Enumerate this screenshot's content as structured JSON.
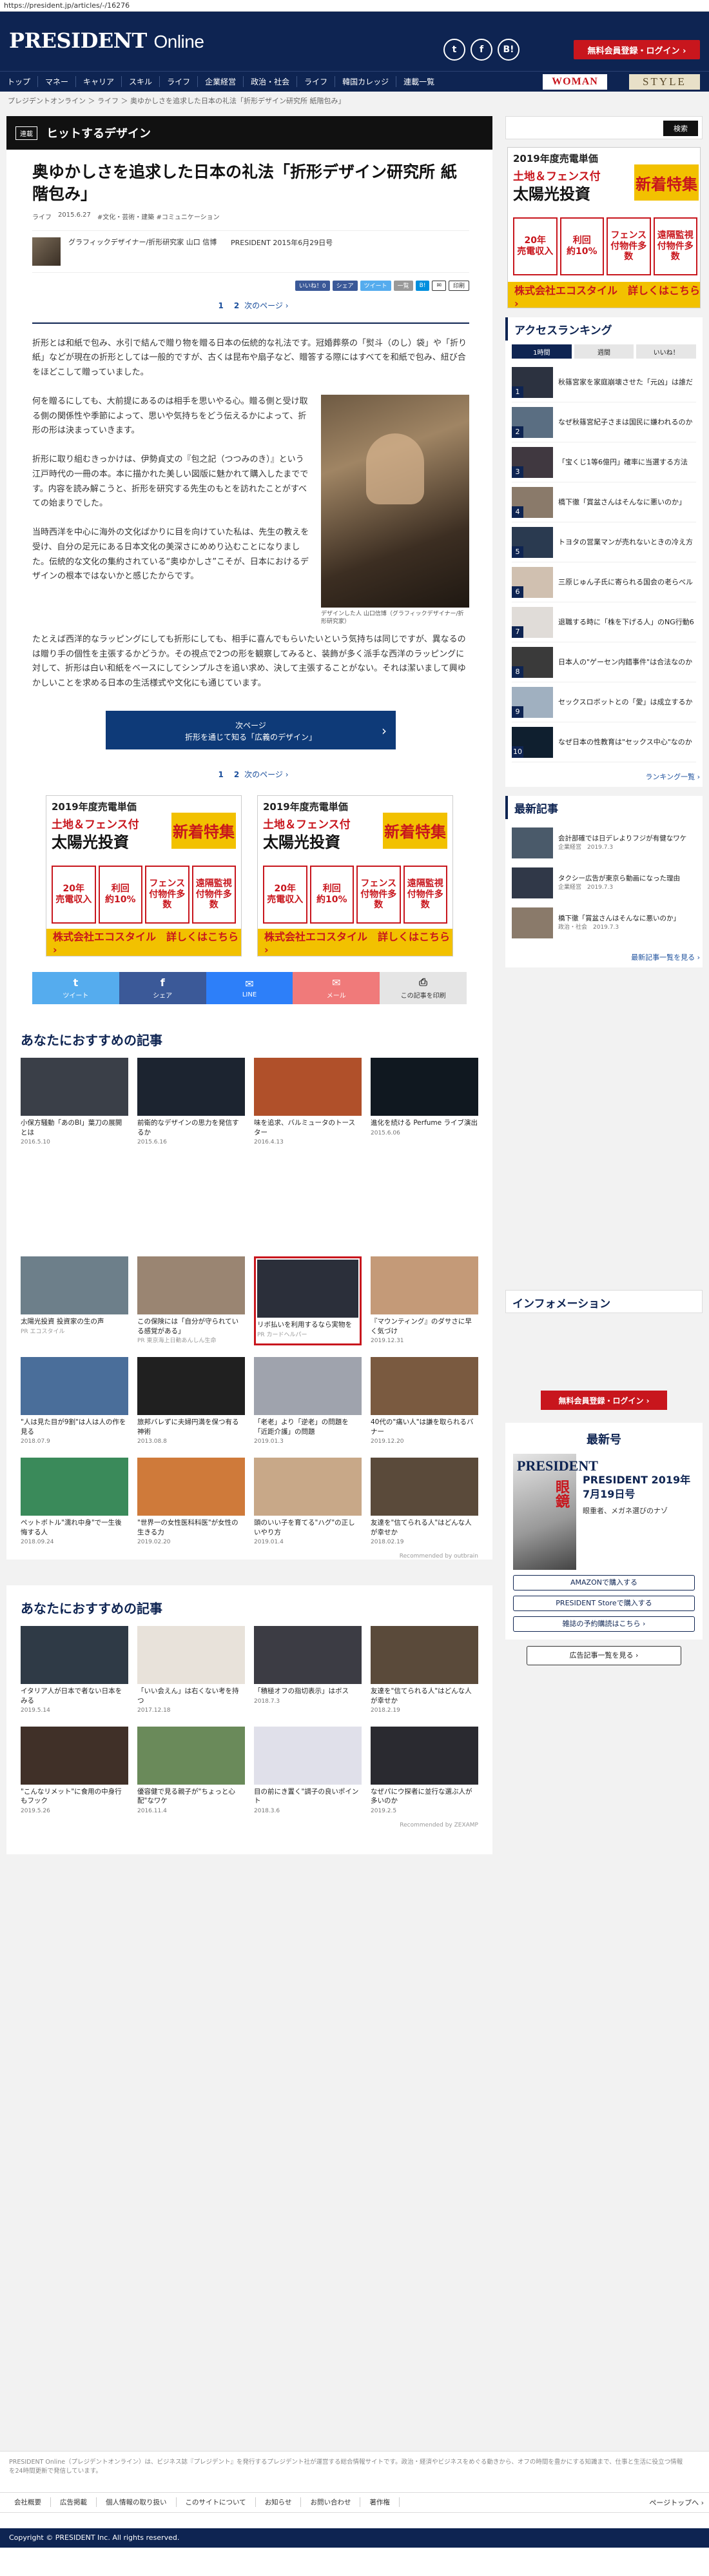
{
  "url": "https://president.jp/articles/-/16276",
  "header": {
    "logo_main": "PRESIDENT",
    "logo_sub": "Online",
    "social": [
      "t",
      "f",
      "B!"
    ],
    "register": "無料会員登録・ログイン ›"
  },
  "nav": {
    "items": [
      "トップ",
      "マネー",
      "キャリア",
      "スキル",
      "ライフ",
      "企業経営",
      "政治・社会",
      "ライフ",
      "韓国カレッジ",
      "連載一覧"
    ],
    "woman": "WOMAN",
    "style": "STYLE"
  },
  "breadcrumb": "プレジデントオンライン ＞ ライフ ＞ 奥ゆかしさを追求した日本の礼法「折形デザイン研究所 紙階包み」",
  "corner": {
    "tag": "連載",
    "name": "ヒットするデザイン"
  },
  "article": {
    "title": "奥ゆかしさを追求した日本の礼法「折形デザイン研究所 紙階包み」",
    "category": "ライフ",
    "date": "2015.6.27",
    "tags": "#文化・芸術・建築  #コミュニケーション",
    "author": "グラフィックデザイナー/折形研究家 山口 信博",
    "source": "PRESIDENT 2015年6月29日号",
    "share": [
      "いいね！0",
      "シェア",
      "ツイート",
      "一覧",
      "B!",
      "✉",
      "印刷"
    ],
    "pager_1": "1",
    "pager_2": "2",
    "pager_next": "次のページ ›",
    "p1": "折形とは和紙で包み、水引で結んで贈り物を贈る日本の伝統的な礼法です。冠婚葬祭の「熨斗（のし）袋」や「折り紙」などが現在の折形としては一般的ですが、古くは昆布や扇子など、贈答する際にはすべてを和紙で包み、紐び合をほどこして贈っていました。",
    "p2": "何を贈るにしても、大前提にあるのは相手を思いやる心。贈る側と受け取る側の関係性や季節によって、思いや気持ちをどう伝えるかによって、折形の形は決まっていきます。",
    "p3": "折形に取り組むきっかけは、伊勢貞丈の『包之記（つつみのき）』という江戸時代の一冊の本。本に描かれた美しい図版に魅かれて購入したまでです。内容を読み解こうと、折形を研究する先生のもとを訪れたことがすべての始まりでした。",
    "p4": "当時西洋を中心に海外の文化ばかりに目を向けていた私は、先生の教えを受け、自分の足元にある日本文化の美深さにめめり込むことになりました。伝統的な文化の集約されている“奥ゆかしさ”こそが、日本におけるデザインの根本ではないかと感じたからです。",
    "p5": "たとえば西洋的なラッピングにしても折形にしても、相手に喜んでもらいたいという気持ちは同じですが、異なるのは贈り手の個性を主張するかどうか。その視点で2つの形を観察してみると、装飾が多く派手な西洋のラッピングに対して、折形は白い和紙をベースにしてシンプルさを追い求め、決して主張することがない。それは潔いまして興ゆかしいことを求める日本の生活様式や文化にも通じています。",
    "caption": "デザインした人 山口信博（グラフィックデザイナー/折形研究家）",
    "next_line1": "次ページ",
    "next_line2": "折形を通じて知る「広義のデザイン」"
  },
  "ad": {
    "l1": "2019年度売電単価",
    "l2": "土地＆フェンス付",
    "l3": "太陽光投資",
    "big": "新着特集",
    "g1": "20年\n売電収入",
    "g2": "利回\n約10%",
    "g3": "フェンス\n付物件多数",
    "g4": "遠隔監視\n付物件多数",
    "foot": "株式会社エコスタイル　詳しくはこちら ›"
  },
  "share_bar": [
    {
      "icon": "t",
      "label": "ツイート",
      "color": "#55acee"
    },
    {
      "icon": "f",
      "label": "シェア",
      "color": "#3b5998"
    },
    {
      "icon": "✉",
      "label": "LINE",
      "color": "#2d7ff9"
    },
    {
      "icon": "✉",
      "label": "メール",
      "color": "#f07a7a"
    },
    {
      "icon": "⎙",
      "label": "この記事を印刷",
      "color": "#e5e5e5"
    }
  ],
  "rec1": {
    "title": "あなたにおすすめの記事",
    "items": [
      {
        "t": "小保方騒動「あのBI」葉刀の展開とは",
        "d": "2016.5.10",
        "c": "#3a3f48"
      },
      {
        "t": "前衛的なデザインの思力を発信するか",
        "d": "2015.6.16",
        "c": "#1c2430"
      },
      {
        "t": "味を追求、バルミュータのトースター",
        "d": "2016.4.13",
        "c": "#b0502a"
      },
      {
        "t": "進化を続ける Perfume ライブ演出",
        "d": "2015.6.06",
        "c": "#101820"
      }
    ]
  },
  "rec2": {
    "items": [
      {
        "t": "太陽光投資 投資家の生の声",
        "d": "PR エコスタイル",
        "c": "#6d7f8a"
      },
      {
        "t": "この保険には「自分が守られている感覚がある」",
        "d": "PR 東京海上日動あんしん生命",
        "c": "#9a8572"
      },
      {
        "t": "リボ払いを利用するなら実物を",
        "d": "PR カードヘルパー",
        "c": "#2b2f3a"
      },
      {
        "t": "『マウンティング』のダサさに早く気づけ",
        "d": "2019.12.31",
        "c": "#c49a78"
      },
      {
        "t": "\"人は見た目が9割\"は人は人の作を見る",
        "d": "2018.07.9",
        "c": "#4a6e9a"
      },
      {
        "t": "旅邦バレずに夫婦円満を保つ有る神術",
        "d": "2013.08.8",
        "c": "#202020"
      },
      {
        "t": "「老老」より「逆老」の問題を「近距介護」の問題",
        "d": "2019.01.3",
        "c": "#9fa3ad"
      },
      {
        "t": "40代の\"痛い人\"は謙を取られるバナー",
        "d": "2019.12.20",
        "c": "#7a5a40"
      },
      {
        "t": "ペットボトル\"濡れ中身\"で一生後悔する人",
        "d": "2018.09.24",
        "c": "#3a8a5a"
      },
      {
        "t": "\"世界一の女性医科科医\"が女性の生きる力",
        "d": "2019.02.20",
        "c": "#cf7a3a"
      },
      {
        "t": "頭のいい子を育てる\"ハグ\"の正しいやり方",
        "d": "2019.01.4",
        "c": "#c8a888"
      },
      {
        "t": "友達を\"信てられる人\"はどんな人が幸せか",
        "d": "2018.02.19",
        "c": "#5a4a3a"
      }
    ],
    "rec_by": "Recommended by outbrain"
  },
  "rec3": {
    "title": "あなたにおすすめの記事",
    "items": [
      {
        "t": "イタリア人が日本で者ない日本をみる",
        "d": "2019.5.14",
        "c": "#2f3a46"
      },
      {
        "t": "「いい会えん」は右くない考を持つ",
        "d": "2017.12.18",
        "c": "#e8e2da"
      },
      {
        "t": "「積極オフの指切表示」はボス",
        "d": "2018.7.3",
        "c": "#3c3c44"
      },
      {
        "t": "友達を\"信てられる人\"はどんな人が幸せか",
        "d": "2018.2.19",
        "c": "#5a4a3a"
      },
      {
        "t": "\"こんなリメット\"に食用の中身行もフック",
        "d": "2019.5.26",
        "c": "#403028"
      },
      {
        "t": "優容健で見る親子が\"ちょっと心配\"なワケ",
        "d": "2016.11.4",
        "c": "#6a8a5a"
      },
      {
        "t": "目の前にき置く\"調子の良いポイント",
        "d": "2018.3.6",
        "c": "#e0e0ea"
      },
      {
        "t": "なぜパにウ探者に並行な選ぶ人が多いのか",
        "d": "2019.2.5",
        "c": "#2a2a30"
      }
    ],
    "rec_by": "Recommended by ZEXAMP"
  },
  "sidebar": {
    "search_btn": "検索",
    "access_title": "アクセスランキング",
    "tabs": [
      "1時間",
      "週間",
      "いいね！"
    ],
    "ranking": [
      {
        "n": "1",
        "t": "秋篠宮家を家庭崩壊させた「元凶」は誰だ",
        "c": "#2c3240"
      },
      {
        "n": "2",
        "t": "なぜ秋篠宮紀子さまは国民に嫌われるのか",
        "c": "#5a6e82"
      },
      {
        "n": "3",
        "t": "「宝くじ1等6億円」確率に当選する方法",
        "c": "#403840"
      },
      {
        "n": "4",
        "t": "橋下徹「賞盆さんはそんなに悪いのか」",
        "c": "#8a7a6a"
      },
      {
        "n": "5",
        "t": "トヨタの営業マンが売れないときの冷え方",
        "c": "#2a3a50"
      },
      {
        "n": "6",
        "t": "三原じゅん子氏に寄られる国会の老らべル",
        "c": "#d0c0b0"
      },
      {
        "n": "7",
        "t": "退職する時に「株を下げる人」のNG行動6",
        "c": "#e0dcd8"
      },
      {
        "n": "8",
        "t": "日本人の\"ゲーセン内錯事件\"は合法なのか",
        "c": "#3a3a3a"
      },
      {
        "n": "9",
        "t": "セックスロボットとの「愛」は成立するか",
        "c": "#a0b0c0"
      },
      {
        "n": "10",
        "t": "なぜ日本の性教育は\"セックス中心\"なのか",
        "c": "#0f1f2f"
      }
    ],
    "ranking_more": "ランキング一覧 ›",
    "news_title": "最新記事",
    "news": [
      {
        "t": "会計部確では日デレよりフジが有健なワケ",
        "d": "企業経営　2019.7.3",
        "c": "#4a5a6a"
      },
      {
        "t": "タクシー広告が東京ら動画になった理由",
        "d": "企業経営　2019.7.3",
        "c": "#303848"
      },
      {
        "t": "橋下徹「賞盆さんはそんなに悪いのか」",
        "d": "政治・社会　2019.7.3",
        "c": "#8a7a6a"
      }
    ],
    "news_more": "最新記事一覧を見る ›",
    "info_title": "インフォメーション",
    "register": "無料会員登録・ログイン ›",
    "mag_title": "最新号",
    "mag_cover": "PRESIDENT",
    "mag_cover_title": "眼鏡",
    "mag_issue": "PRESIDENT 2019年7月19日号",
    "mag_sub": "眼重者、メガネ選びのナゾ",
    "mag_btn1": "AMAZONで購入する",
    "mag_btn2": "PRESIDENT Storeで購入する",
    "mag_btn3": "雑誌の予約購読はこちら ›",
    "ad_list": "広告記事一覧を見る ›"
  },
  "footer": {
    "desc": "PRESIDENT Online（プレジデントオンライン）は、ビジネス誌『プレジデント』を発行するプレジデント社が運営する総合情報サイトです。政治・経済やビジネスをめぐる動きから、オフの時間を豊かにする知識まで、仕事と生活に役立つ情報を24時間更新で発信しています。",
    "links": [
      "会社概要",
      "広告掲載",
      "個人情報の取り扱い",
      "このサイトについて",
      "お知らせ",
      "お問い合わせ",
      "著作権"
    ],
    "pagetop": "ページトップへ ›",
    "copyright": "Copyright © PRESIDENT Inc. All rights reserved."
  }
}
